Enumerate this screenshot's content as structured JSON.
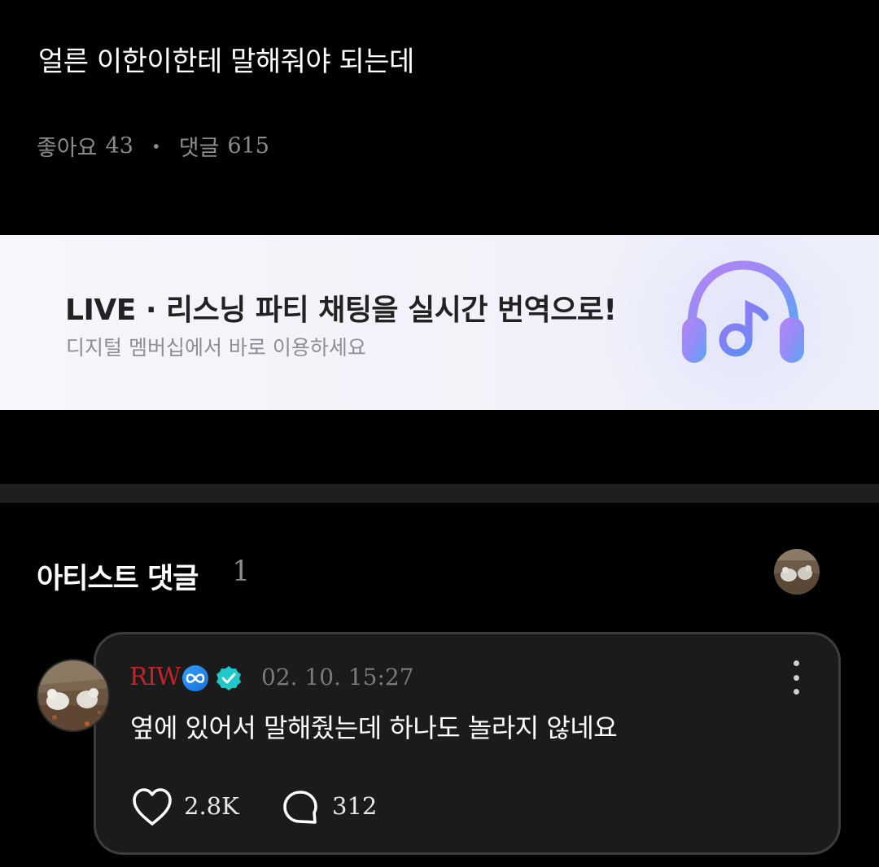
{
  "post": {
    "body": "얼른 이한이한테 말해줘야 되는데",
    "likes_label": "좋아요",
    "likes_count": "43",
    "separator": "•",
    "comments_label": "댓글",
    "comments_count": "615"
  },
  "banner": {
    "title": "LIVE · 리스닝 파티 채팅을 실시간 번역으로!",
    "subtitle": "디지털 멤버십에서 바로 이용하세요",
    "icon": "headphone-music-icon"
  },
  "artist_comments": {
    "title": "아티스트 댓글",
    "count": "1"
  },
  "comment": {
    "author": "RIW",
    "badges": [
      "infinity-icon",
      "verified-icon"
    ],
    "time": "02. 10. 15:27",
    "text": "옆에 있어서 말해줬는데 하나도 놀라지 않네요",
    "like_count": "2.8K",
    "reply_count": "312"
  },
  "colors": {
    "background": "#000000",
    "author": "#c3232a",
    "verified": "#1ec7c8",
    "card": "#1b1b1b"
  }
}
